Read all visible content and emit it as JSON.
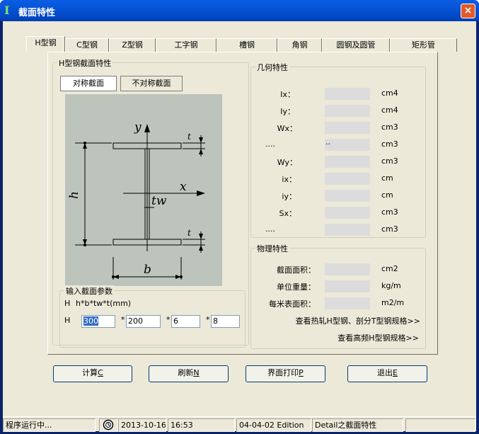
{
  "window": {
    "title": "截面特性",
    "close": "×"
  },
  "tabs": [
    "H型钢",
    "C型钢",
    "Z型钢",
    "工字钢",
    "槽钢",
    "角钢",
    "圆钢及圆管",
    "矩形管"
  ],
  "section_group": {
    "title": "H型钢截面特性",
    "sym": "对称截面",
    "asym": "不对称截面"
  },
  "diagram": {
    "y": "y",
    "x": "x",
    "t": "t",
    "h": "h",
    "tw": "tw",
    "b": "b"
  },
  "input": {
    "title": "输入截面参数",
    "formula_prefix": "H",
    "formula": "h*b*tw*t(mm)",
    "row_label": "H",
    "h": "300",
    "b": "200",
    "tw": "6",
    "t": "8",
    "star": "*"
  },
  "geom": {
    "title": "几何特性",
    "rows": [
      {
        "label": "Ix：",
        "value": "",
        "unit": "cm4"
      },
      {
        "label": "Iy：",
        "value": "",
        "unit": "cm4"
      },
      {
        "label": "Wx：",
        "value": "",
        "unit": "cm3"
      },
      {
        "label": "....",
        "value": "..",
        "unit": "cm3"
      },
      {
        "label": "Wy：",
        "value": "",
        "unit": "cm3"
      },
      {
        "label": "ix：",
        "value": "",
        "unit": "cm"
      },
      {
        "label": "iy：",
        "value": "",
        "unit": "cm"
      },
      {
        "label": "Sx：",
        "value": "",
        "unit": "cm3"
      },
      {
        "label": "....",
        "value": "",
        "unit": "cm3"
      }
    ]
  },
  "phys": {
    "title": "物理特性",
    "rows": [
      {
        "label": "截面面积：",
        "value": "",
        "unit": "cm2"
      },
      {
        "label": "单位重量：",
        "value": "",
        "unit": "kg/m"
      },
      {
        "label": "每米表面积：",
        "value": "",
        "unit": "m2/m"
      }
    ],
    "link1": "查看热轧H型钢、剖分T型钢规格>>",
    "link2": "查看高频H型钢规格>>"
  },
  "buttons": [
    {
      "label": "计算",
      "key": "C"
    },
    {
      "label": "刷新",
      "key": "N"
    },
    {
      "label": "界面打印",
      "key": "P"
    },
    {
      "label": "退出",
      "key": "E"
    }
  ],
  "status": {
    "s1": "程序运行中...",
    "date": "2013-10-16",
    "time": "16:53",
    "edition": "04-04-02 Edition",
    "module": "Detail之截面特性"
  }
}
